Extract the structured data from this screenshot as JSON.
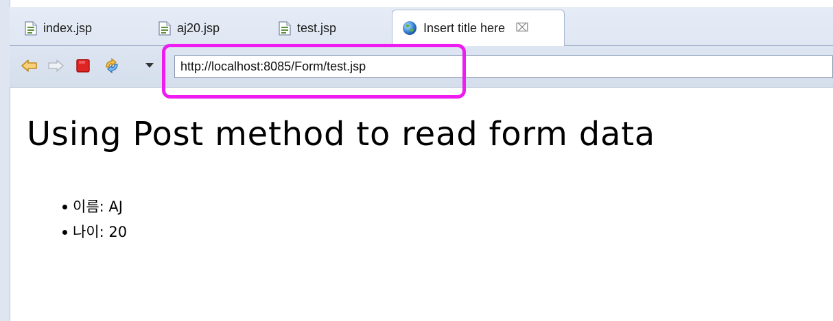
{
  "tabs": [
    {
      "label": "index.jsp",
      "icon": "jsp-file-icon"
    },
    {
      "label": "aj20.jsp",
      "icon": "jsp-file-icon"
    },
    {
      "label": "test.jsp",
      "icon": "jsp-file-icon"
    },
    {
      "label": "Insert title here",
      "icon": "globe-icon",
      "active": true,
      "close": "⌧"
    }
  ],
  "toolbar": {
    "back_icon": "back-arrow-icon",
    "forward_icon": "forward-arrow-icon",
    "stop_icon": "stop-icon",
    "refresh_icon": "refresh-icon",
    "dropdown_icon": "dropdown-arrow-icon",
    "url": "http://localhost:8085/Form/test.jsp"
  },
  "highlight_color": "#ee1cf0",
  "page": {
    "heading": "Using Post method to read form data",
    "items": [
      {
        "label": "이름",
        "separator": ":",
        "value": "AJ",
        "text": "이름: AJ"
      },
      {
        "label": "나이",
        "separator": ":",
        "value": "20",
        "text": "나이: 20"
      }
    ]
  }
}
